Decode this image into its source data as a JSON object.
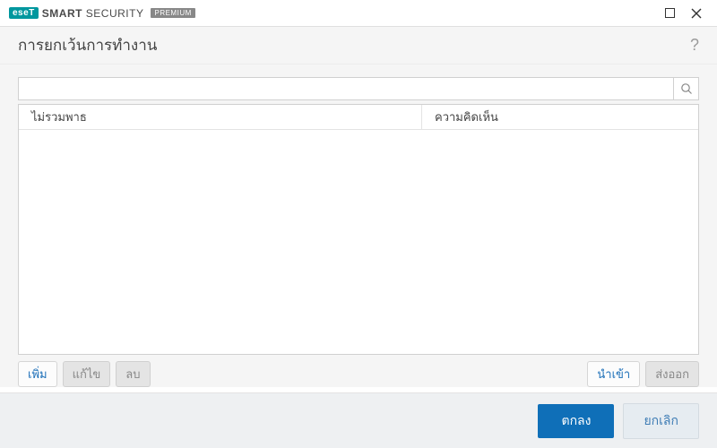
{
  "brand": {
    "badge": "eseT",
    "name_bold": "SMART",
    "name_rest": " SECURITY",
    "premium": "PREMIUM"
  },
  "page": {
    "title": "การยกเว้นการทำงาน"
  },
  "search": {
    "value": ""
  },
  "table": {
    "col1": "ไม่รวมพาธ",
    "col2": "ความคิดเห็น"
  },
  "actions": {
    "add": "เพิ่ม",
    "edit": "แก้ไข",
    "delete": "ลบ",
    "import": "นำเข้า",
    "export": "ส่งออก"
  },
  "footer": {
    "ok": "ตกลง",
    "cancel": "ยกเลิก"
  }
}
